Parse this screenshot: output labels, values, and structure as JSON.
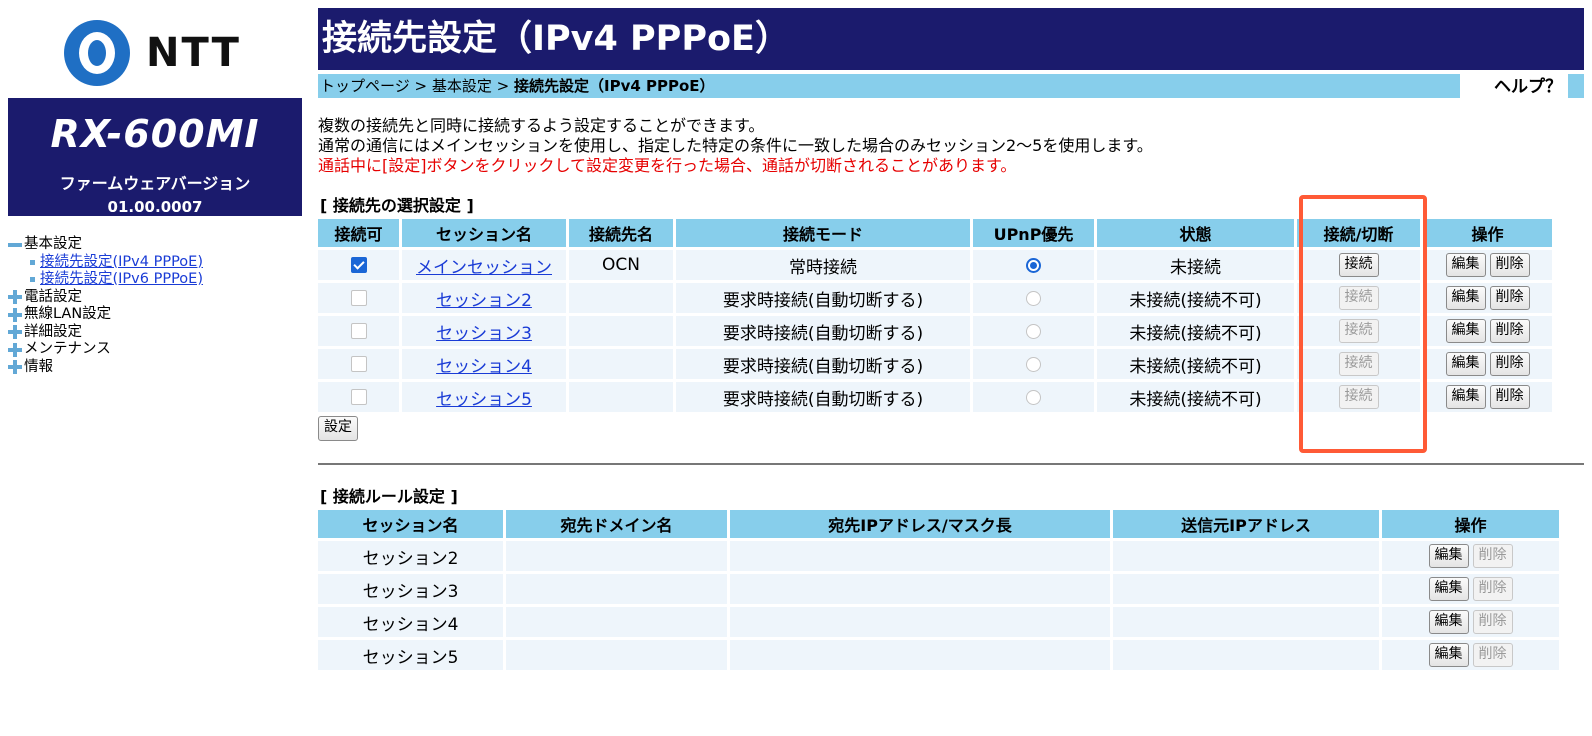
{
  "brand": {
    "logo_text": "NTT"
  },
  "device": {
    "model": "RX-600MI",
    "firmware_label": "ファームウェアバージョン",
    "firmware_version": "01.00.0007"
  },
  "nav": {
    "basic": "基本設定",
    "basic_sub": [
      "接続先設定(IPv4 PPPoE)",
      "接続先設定(IPv6 PPPoE)"
    ],
    "phone": "電話設定",
    "wireless": "無線LAN設定",
    "detail": "詳細設定",
    "maintenance": "メンテナンス",
    "info": "情報"
  },
  "page": {
    "title": "接続先設定（IPv4 PPPoE）",
    "breadcrumb": {
      "top": "トップページ",
      "sep": ">",
      "basic": "基本設定",
      "current": "接続先設定（IPv4 PPPoE）"
    },
    "help": "ヘルプ？",
    "intro_1": "複数の接続先と同時に接続するよう設定することができます。",
    "intro_2": "通常の通信にはメインセッションを使用し、指定した特定の条件に一致した場合のみセッション2～5を使用します。",
    "warning": "通話中に[設定]ボタンをクリックして設定変更を行った場合、通話が切断されることがあります。"
  },
  "selection": {
    "title": "[ 接続先の選択設定 ]",
    "headers": [
      "接続可",
      "セッション名",
      "接続先名",
      "接続モード",
      "UPnP優先",
      "状態",
      "接続/切断",
      "操作"
    ],
    "rows": [
      {
        "name": "メインセッション",
        "provider": "OCN",
        "mode": "常時接続",
        "status": "未接続",
        "enabled": true,
        "upnp": true,
        "connect_enabled": true
      },
      {
        "name": "セッション2",
        "provider": "",
        "mode": "要求時接続(自動切断する)",
        "status": "未接続(接続不可)",
        "enabled": false,
        "upnp": false,
        "connect_enabled": false
      },
      {
        "name": "セッション3",
        "provider": "",
        "mode": "要求時接続(自動切断する)",
        "status": "未接続(接続不可)",
        "enabled": false,
        "upnp": false,
        "connect_enabled": false
      },
      {
        "name": "セッション4",
        "provider": "",
        "mode": "要求時接続(自動切断する)",
        "status": "未接続(接続不可)",
        "enabled": false,
        "upnp": false,
        "connect_enabled": false
      },
      {
        "name": "セッション5",
        "provider": "",
        "mode": "要求時接続(自動切断する)",
        "status": "未接続(接続不可)",
        "enabled": false,
        "upnp": false,
        "connect_enabled": false
      }
    ],
    "connect_label": "接続",
    "edit_label": "編集",
    "delete_label": "削除",
    "set_label": "設定"
  },
  "rules": {
    "title": "[ 接続ルール設定 ]",
    "headers": [
      "セッション名",
      "宛先ドメイン名",
      "宛先IPアドレス/マスク長",
      "送信元IPアドレス",
      "操作"
    ],
    "rows": [
      {
        "name": "セッション2",
        "domain": "",
        "dest_ip": "",
        "src_ip": ""
      },
      {
        "name": "セッション3",
        "domain": "",
        "dest_ip": "",
        "src_ip": ""
      },
      {
        "name": "セッション4",
        "domain": "",
        "dest_ip": "",
        "src_ip": ""
      },
      {
        "name": "セッション5",
        "domain": "",
        "dest_ip": "",
        "src_ip": ""
      }
    ],
    "edit_label": "編集",
    "delete_label": "削除"
  },
  "colors": {
    "navy": "#1b1b6d",
    "sky": "#87ceeb",
    "highlight": "#ff5a36",
    "warning": "#e60000",
    "link": "#1a3cd6"
  }
}
